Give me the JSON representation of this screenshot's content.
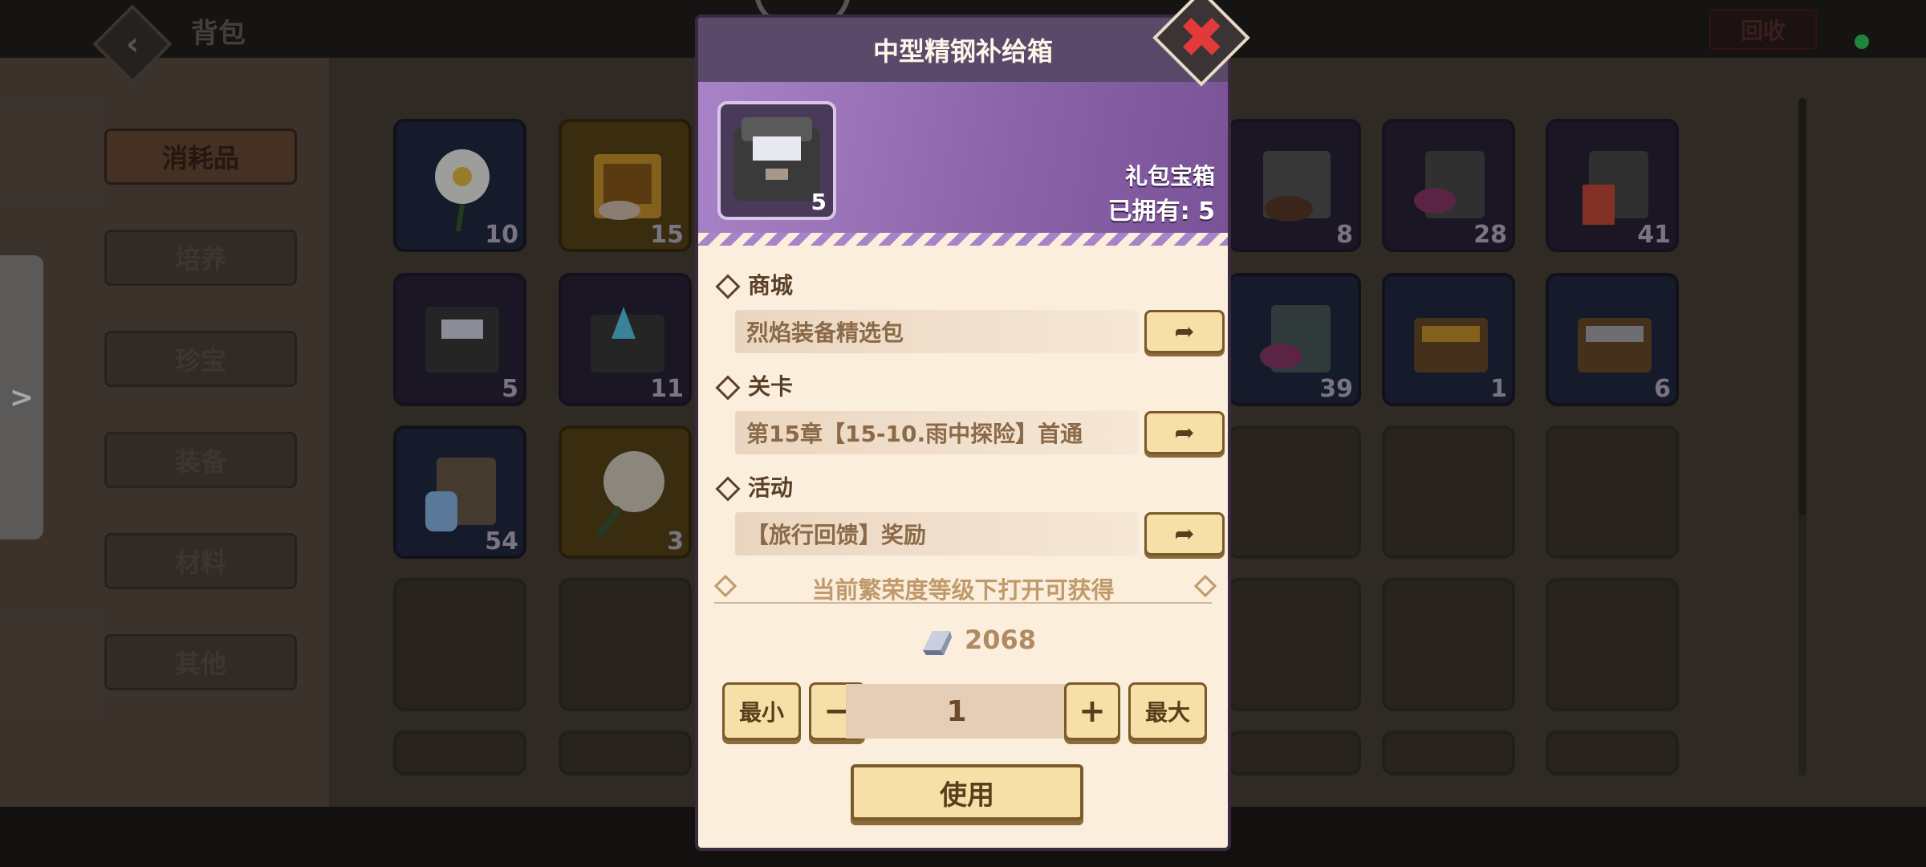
{
  "header": {
    "title": "背包",
    "recycle_label": "回收"
  },
  "categories": [
    "消耗品",
    "培养",
    "珍宝",
    "装备",
    "材料",
    "其他"
  ],
  "side_tab": {
    "arrow": ">"
  },
  "inventory": {
    "slots": [
      {
        "count": "10"
      },
      {
        "count": "15"
      },
      {
        "count": ""
      },
      {
        "count": ""
      },
      {
        "count": "8"
      },
      {
        "count": "28"
      },
      {
        "count": "41"
      },
      {
        "count": "5"
      },
      {
        "count": "11"
      },
      {
        "count": ""
      },
      {
        "count": ""
      },
      {
        "count": "39"
      },
      {
        "count": "1"
      },
      {
        "count": "6"
      },
      {
        "count": "54"
      },
      {
        "count": "3"
      }
    ]
  },
  "modal": {
    "title": "中型精钢补给箱",
    "icon_count": "5",
    "type": "礼包宝箱",
    "owned": "已拥有: 5",
    "sources": [
      {
        "section": "商城",
        "text": "烈焰装备精选包",
        "go": "➦"
      },
      {
        "section": "关卡",
        "text": "第15章【15-10.雨中探险】首通",
        "go": "➦"
      },
      {
        "section": "活动",
        "text": "【旅行回馈】奖励",
        "go": "➦"
      }
    ],
    "hint": "当前繁荣度等级下打开可获得",
    "reward_amount": "2068",
    "qty": {
      "min_label": "最小",
      "minus": "−",
      "value": "1",
      "plus": "+",
      "max_label": "最大"
    },
    "use_label": "使用",
    "close": "✖"
  },
  "colors": {
    "accent_purple": "#a983c8",
    "button": "#f7dfa8",
    "modal_bg": "#fbeedd",
    "status_green": "#2ecc5e"
  },
  "icons": [
    "back-icon",
    "close-icon",
    "go-arrow-icon",
    "silver-ingot-icon",
    "chest-icon"
  ]
}
